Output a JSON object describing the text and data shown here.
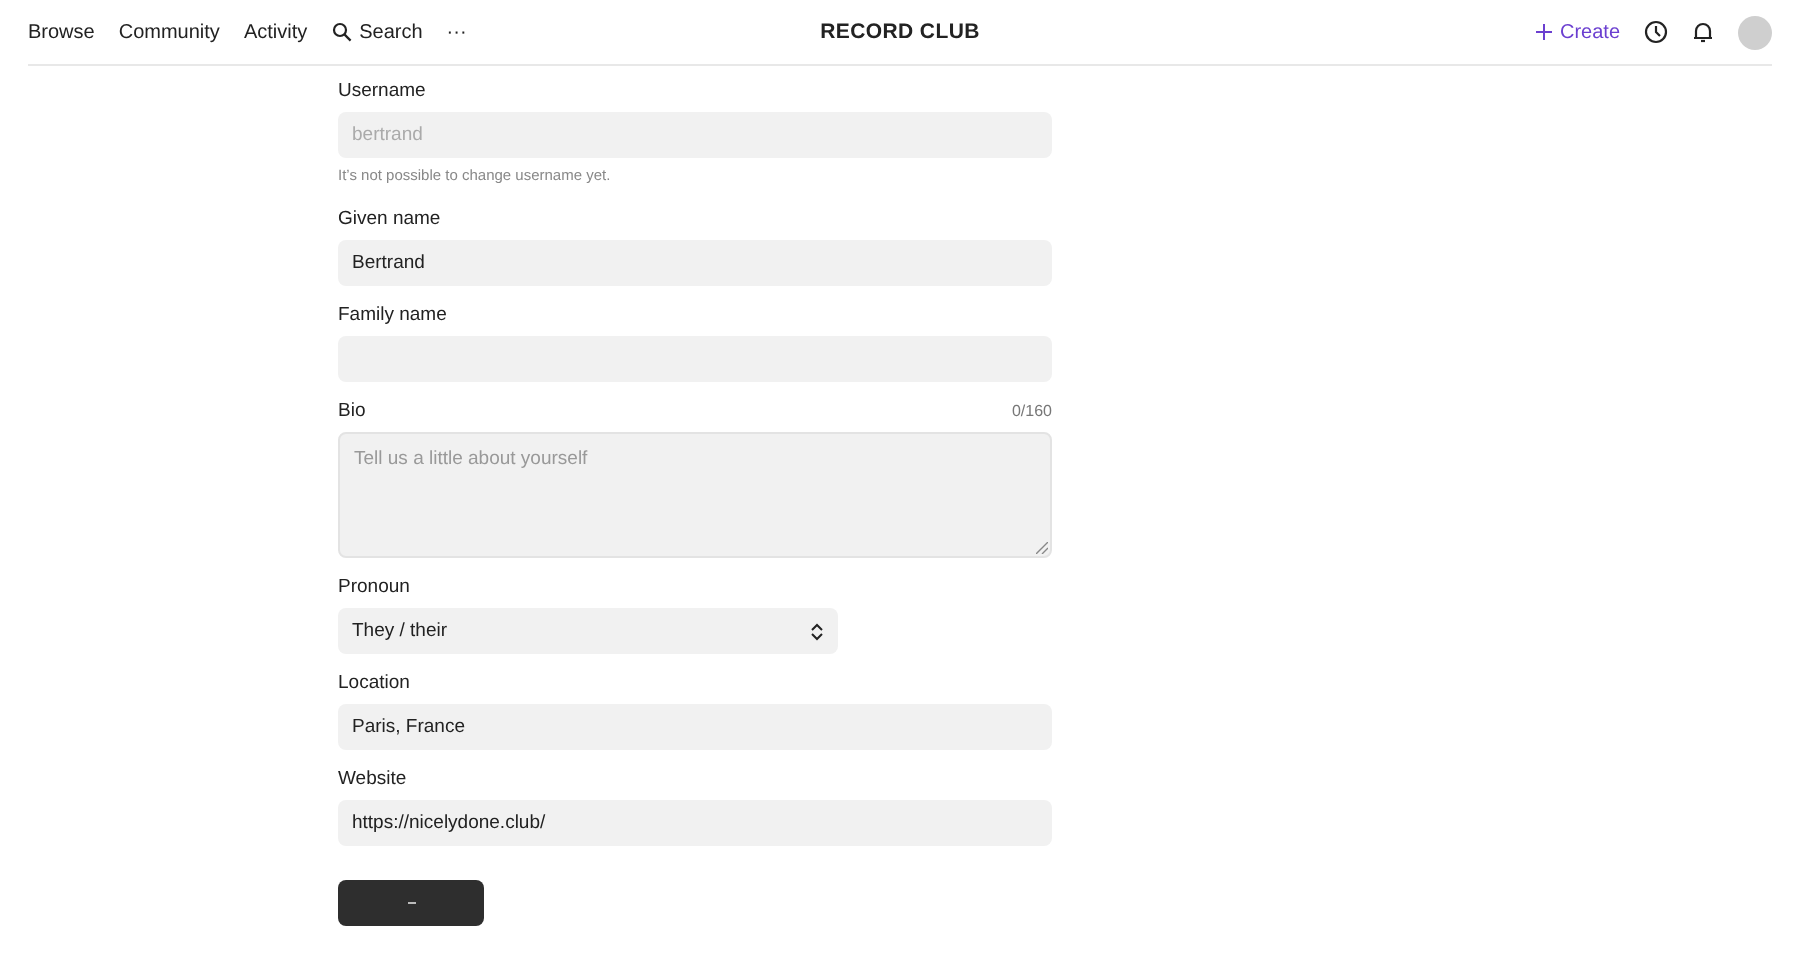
{
  "nav": {
    "links": [
      {
        "label": "Browse"
      },
      {
        "label": "Community"
      },
      {
        "label": "Activity"
      }
    ],
    "search": {
      "label": "Search"
    },
    "more": "···",
    "logo": "RECORD CLUB",
    "create": {
      "label": "Create"
    }
  },
  "form": {
    "username": {
      "label": "Username",
      "value": "bertrand",
      "disabled": true,
      "hint": "It’s not possible to change username yet."
    },
    "given_name": {
      "label": "Given name",
      "value": "Bertrand"
    },
    "family_name": {
      "label": "Family name"
    },
    "bio": {
      "label": "Bio",
      "counter": "0/160",
      "placeholder": "Tell us a little about yourself"
    },
    "pronoun": {
      "label": "Pronoun",
      "value": "They / their"
    },
    "location": {
      "label": "Location",
      "value": "Paris, France"
    },
    "website": {
      "label": "Website",
      "value": "https://nicelydone.club/"
    },
    "submit": {
      "loading": true
    }
  }
}
